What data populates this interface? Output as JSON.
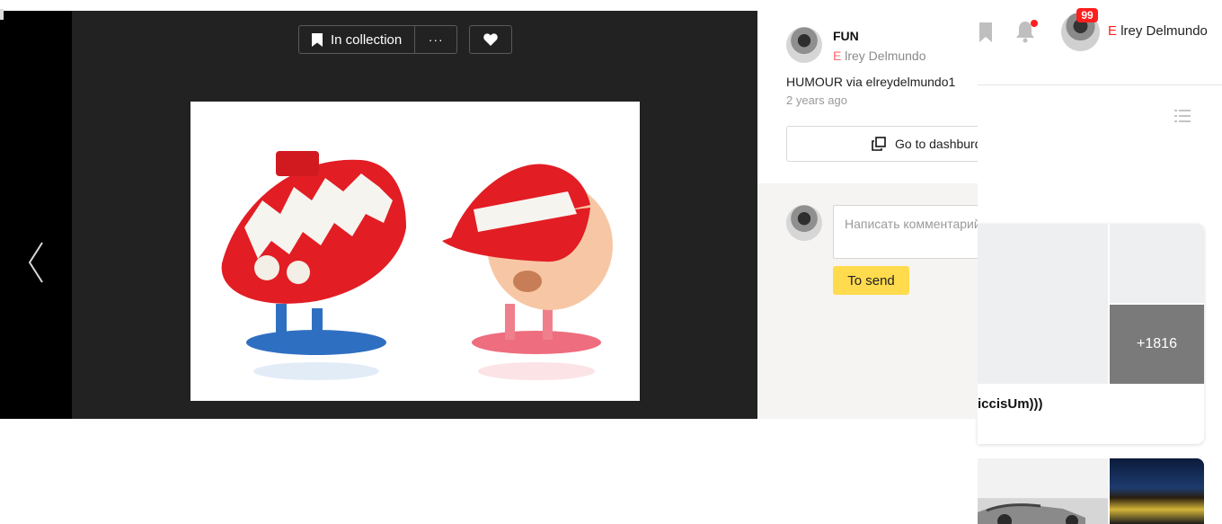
{
  "toolbar": {
    "collection_label": "In collection",
    "more_label": "···"
  },
  "pin": {
    "board_name": "FUN",
    "author_initial": "E",
    "author_name": "lrey Delmundo",
    "description": "HUMOUR via elreydelmundo1",
    "time_ago": "2 years ago",
    "dashboard_label": "Go to dashburd"
  },
  "comments": {
    "placeholder": "Написать комментарий",
    "send_label": "To send"
  },
  "header": {
    "notification_count": "99",
    "user_initial": "E",
    "user_name": "lrey Delmundo"
  },
  "collection_card": {
    "more_count": "+1816",
    "title": "iccisUm)))"
  },
  "icons": {
    "prev": "chevron-left-icon",
    "bookmark": "bookmark-icon",
    "more": "ellipsis-icon",
    "like": "heart-icon",
    "dashboard": "copy-icon",
    "header_bookmark": "bookmark-icon",
    "bell": "bell-icon",
    "list": "list-icon"
  },
  "colors": {
    "viewer_bg": "#222222",
    "accent_yellow": "#ffdb4d",
    "badge_red": "#ff1f1f",
    "comments_bg": "#f5f4f2"
  }
}
